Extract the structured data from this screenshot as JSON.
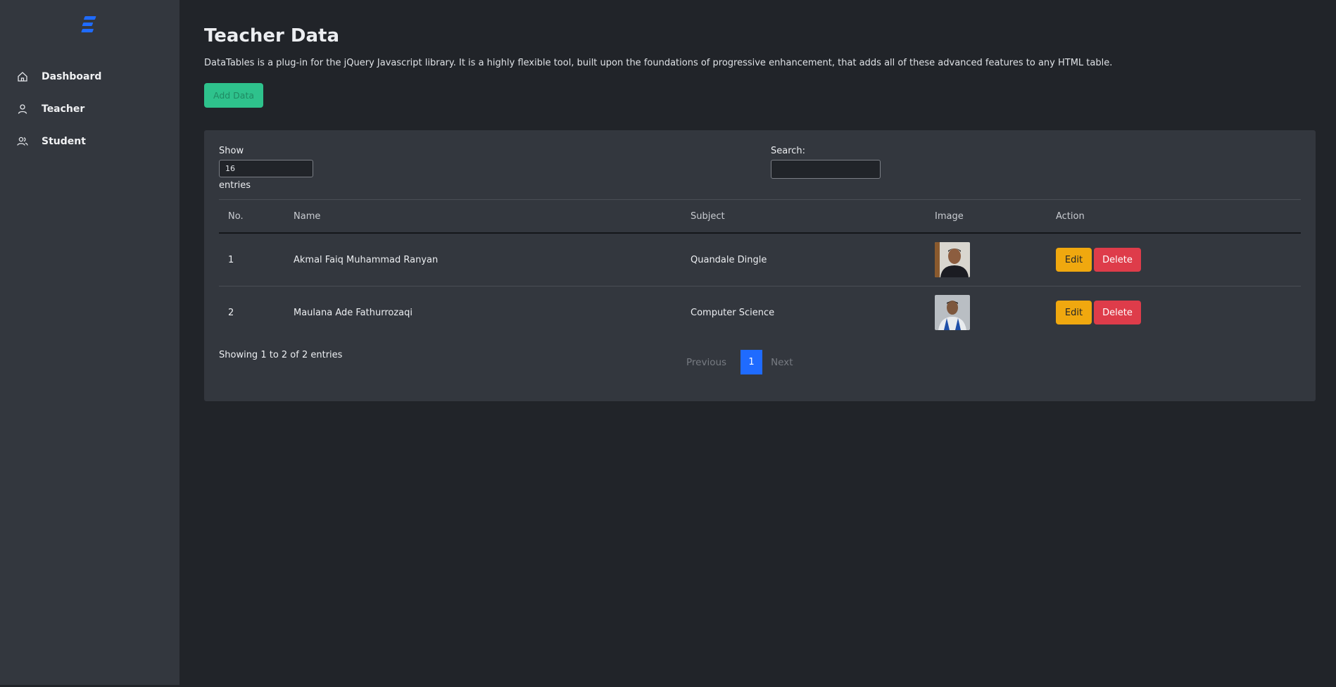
{
  "sidebar": {
    "logo_icon": "stacked-bars-logo",
    "accent": "#1f6bff",
    "items": [
      {
        "label": "Dashboard",
        "icon": "home-icon"
      },
      {
        "label": "Teacher",
        "icon": "user-icon"
      },
      {
        "label": "Student",
        "icon": "users-icon"
      }
    ]
  },
  "page": {
    "title": "Teacher Data",
    "description": "DataTables is a plug-in for the jQuery Javascript library. It is a highly flexible tool, built upon the foundations of progressive enhancement, that adds all of these advanced features to any HTML table.",
    "add_button": "Add Data"
  },
  "table": {
    "show_label": "Show",
    "show_value": "16",
    "entries_label": "entries",
    "search_label": "Search:",
    "search_value": "",
    "columns": [
      "No.",
      "Name",
      "Subject",
      "Image",
      "Action"
    ],
    "rows": [
      {
        "no": "1",
        "name": "Akmal Faiq Muhammad Ranyan",
        "subject": "Quandale Dingle",
        "image": "teacher-photo",
        "edit": "Edit",
        "delete": "Delete"
      },
      {
        "no": "2",
        "name": "Maulana Ade Fathurrozaqi",
        "subject": "Computer Science",
        "image": "teacher-photo",
        "edit": "Edit",
        "delete": "Delete"
      }
    ],
    "info": "Showing 1 to 2 of 2 entries",
    "pagination": {
      "previous": "Previous",
      "current": "1",
      "next": "Next"
    }
  },
  "colors": {
    "background": "#212429",
    "panel": "#33373e",
    "add_button": "#2ec28c",
    "edit_button": "#f0a80f",
    "delete_button": "#de3c4a",
    "page_active": "#1f6bff"
  }
}
